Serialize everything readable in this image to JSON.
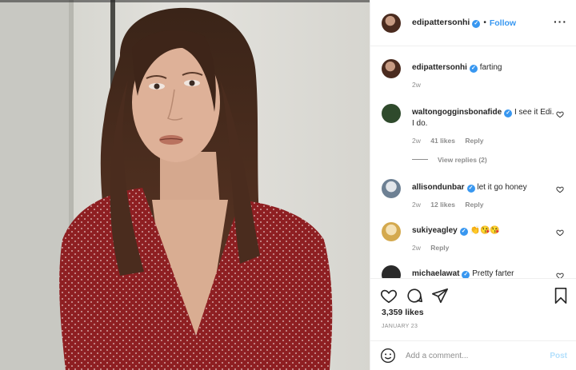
{
  "post": {
    "username": "edipattersonhi",
    "follow_label": "Follow",
    "separator": "•",
    "more_glyph": "···"
  },
  "caption": {
    "username": "edipattersonhi",
    "text": "farting",
    "age": "2w"
  },
  "comments": [
    {
      "username": "waltongogginsbonafide",
      "text": "I see it Edi. I do.",
      "age": "2w",
      "likes": "41 likes",
      "reply": "Reply",
      "avatar_color": "#2f4a2c"
    },
    {
      "username": "allisondunbar",
      "text": "let it go honey",
      "age": "2w",
      "likes": "12 likes",
      "reply": "Reply",
      "avatar_color": "#7c8ea0"
    },
    {
      "username": "sukiyeagley",
      "text": "👏😘😘",
      "age": "2w",
      "likes": "",
      "reply": "Reply",
      "avatar_color": "#d9b56a"
    },
    {
      "username": "michaelawat",
      "text": "Pretty farter",
      "age": "",
      "likes": "",
      "reply": "",
      "avatar_color": "#2a2a2a"
    }
  ],
  "view_replies": "View replies (2)",
  "likes_count": "3,359 likes",
  "date": "JANUARY 23",
  "add_comment": {
    "placeholder": "Add a comment...",
    "post_label": "Post"
  },
  "icons": [
    "heart-icon",
    "comment-icon",
    "share-icon",
    "bookmark-icon",
    "emoji-icon",
    "verified-badge-icon",
    "more-options-icon"
  ],
  "colors": {
    "accent": "#3897f0",
    "muted": "#8e8e8e",
    "text": "#262626",
    "dress": "#8e1f22"
  }
}
